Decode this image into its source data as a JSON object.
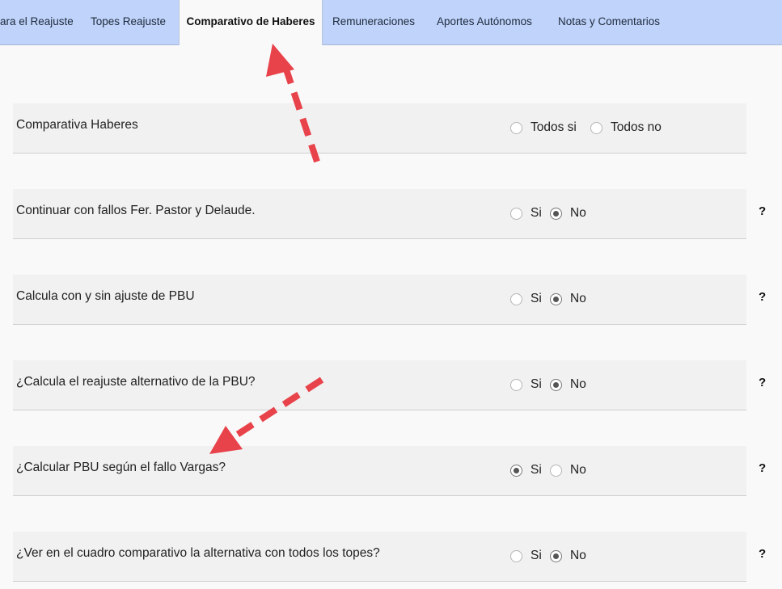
{
  "tabs": [
    {
      "label": "ara el Reajuste",
      "active": false
    },
    {
      "label": "Topes Reajuste",
      "active": false
    },
    {
      "label": "Comparativo de Haberes",
      "active": true
    },
    {
      "label": "Remuneraciones",
      "active": false
    },
    {
      "label": "Aportes Autónomos",
      "active": false
    },
    {
      "label": "Notas y Comentarios",
      "active": false
    }
  ],
  "rows": [
    {
      "label": "Comparativa Haberes",
      "options": [
        "Todos si",
        "Todos no"
      ],
      "selected": null,
      "help": ""
    },
    {
      "label": "Continuar con fallos Fer. Pastor y Delaude.",
      "options": [
        "Si",
        "No"
      ],
      "selected": "No",
      "help": "?"
    },
    {
      "label": "Calcula con y sin ajuste de PBU",
      "options": [
        "Si",
        "No"
      ],
      "selected": "No",
      "help": "?"
    },
    {
      "label": "¿Calcula el reajuste alternativo de la PBU?",
      "options": [
        "Si",
        "No"
      ],
      "selected": "No",
      "help": "?"
    },
    {
      "label": "¿Calcular PBU según el fallo Vargas?",
      "options": [
        "Si",
        "No"
      ],
      "selected": "Si",
      "help": "?"
    },
    {
      "label": "¿Ver en el cuadro comparativo la alternativa con todos los topes?",
      "options": [
        "Si",
        "No"
      ],
      "selected": "No",
      "help": "?"
    }
  ],
  "colors": {
    "tabbar_bg": "#bfd3fb",
    "row_bg": "#f1f1f1",
    "annotation_arrow": "#e8424a"
  }
}
